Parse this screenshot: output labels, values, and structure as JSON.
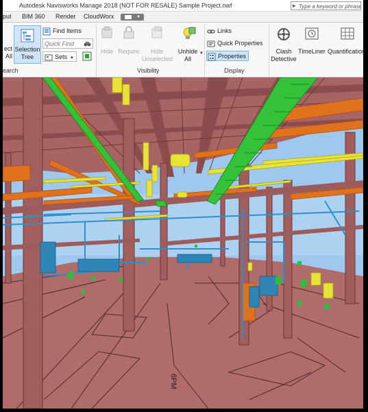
{
  "titlebar": {
    "title": "Autodesk Navisworks Manage 2018 (NOT FOR RESALE)    Sample Project.nwf",
    "search_placeholder": "Type a keyword or phrase"
  },
  "tabs": [
    {
      "label": "put"
    },
    {
      "label": "BIM 360"
    },
    {
      "label": "Render"
    },
    {
      "label": "CloudWorx"
    }
  ],
  "ribbon": {
    "select": {
      "partial_label_1": "ect",
      "partial_label_2": "All",
      "selection_tree_1": "Selection",
      "selection_tree_2": "Tree",
      "find_items": "Find Items",
      "quick_find_placeholder": "Quick Find",
      "sets": "Sets",
      "panel_label": "earch"
    },
    "visibility": {
      "hide": "Hide",
      "require": "Require",
      "hide_unselected_1": "Hide",
      "hide_unselected_2": "Unselected",
      "unhide_1": "Unhide",
      "unhide_2": "All",
      "panel_label": "Visibility"
    },
    "display": {
      "links": "Links",
      "quick_properties": "Quick Properties",
      "properties": "Properties",
      "panel_label": "Display"
    },
    "tools": {
      "clash_1": "Clash",
      "clash_2": "Detective",
      "timeliner": "TimeLiner",
      "quantification": "Quantification"
    }
  },
  "viewport": {
    "floor_marking": "6PM",
    "colors": {
      "steel": "#b06b6b",
      "steel_dark": "#8a4c4c",
      "duct_orange": "#e0721e",
      "tray_green": "#33c23a",
      "pipe_yellow": "#e8e337",
      "pipe_blue": "#2e90c8",
      "sky": "#9ec7ee"
    }
  }
}
